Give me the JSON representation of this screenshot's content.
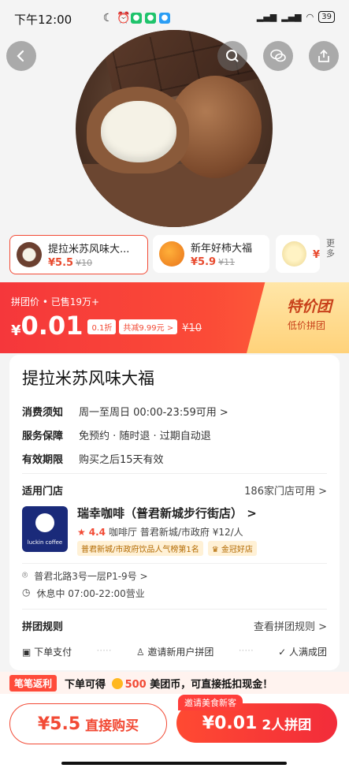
{
  "status_bar": {
    "time": "下午12:00",
    "battery": "39"
  },
  "thumbnails": [
    {
      "name": "提拉米苏风味大...",
      "price": "¥5.5",
      "orig": "¥10"
    },
    {
      "name": "新年好柿大福",
      "price": "¥5.9",
      "orig": "¥11"
    },
    {
      "name": "",
      "price": "¥",
      "orig": ""
    }
  ],
  "more_label": "更多",
  "banner": {
    "label": "拼团价 • 已售19万+",
    "price_symbol": "¥",
    "price_value": "0.01",
    "discount": "0.1折",
    "saving": "共减9.99元 >",
    "orig": "¥10",
    "ribbon_title": "特价团",
    "ribbon_sub": "低价拼团"
  },
  "product": {
    "title": "提拉米苏风味大福",
    "rows": [
      {
        "k": "消费须知",
        "v": "周一至周日 00:00-23:59可用 >"
      },
      {
        "k": "服务保障",
        "v": "免预约 · 随时退 · 过期自动退"
      },
      {
        "k": "有效期限",
        "v": "购买之后15天有效"
      }
    ]
  },
  "store_section": {
    "title": "适用门店",
    "count": "186家门店可用 >",
    "logo_text": "luckin coffee",
    "name": "瑞幸咖啡（普君新城步行街店） >",
    "rating": "4.4",
    "meta": "咖啡厅  普君新城/市政府  ¥12/人",
    "rank_tag": "普君新城/市政府饮品人气榜第1名",
    "gold_tag": "金冠好店",
    "address": "普君北路3号一层P1-9号 >",
    "hours": "休息中 07:00-22:00营业"
  },
  "group_rules": {
    "title": "拼团规则",
    "link": "查看拼团规则 >",
    "steps": [
      "下单支付",
      "邀请新用户拼团",
      "人满成团"
    ]
  },
  "rebate": {
    "badge": "笔笔返利",
    "text_before": "下单可得",
    "coins": "500",
    "text_after": "美团币，可直接抵扣现金！"
  },
  "bottom": {
    "buy_price": "¥5.5",
    "buy_label": "直接购买",
    "tip": "邀请美食新客",
    "group_price": "¥0.01",
    "group_label": "2人拼团"
  },
  "colors": {
    "accent": "#f24a35",
    "ribbon": "#ffd27a"
  }
}
